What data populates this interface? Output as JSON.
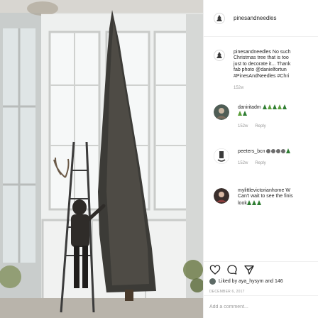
{
  "post": {
    "author": "pinesandneedles",
    "caption_lines": [
      "No such",
      "Christmas tree that is too",
      "just to decorate it... Thank",
      "fab photo @danielfortun",
      "#PinesAndNeedles #Chri"
    ],
    "caption_time": "152w"
  },
  "comments": [
    {
      "user": "daniritadm",
      "time": "152w",
      "reply": "Reply"
    },
    {
      "user": "peeters_bcn",
      "time": "152w",
      "reply": "Reply"
    },
    {
      "user": "mylittlevictorianhome",
      "text_line1": "W",
      "text_line2": "Can't wait to see the finis",
      "text_line3": "look"
    }
  ],
  "likes": {
    "text": "Liked by aya_hysym and 146"
  },
  "date": "DECEMBER 6, 2017",
  "add_comment": {
    "placeholder": "Add a comment..."
  },
  "colors": {
    "text": "#262626",
    "muted": "#999999",
    "border": "#efefef",
    "tree": "#2e7d32"
  },
  "icons": [
    "pine-logo-icon",
    "heart-icon",
    "comment-icon",
    "share-icon"
  ]
}
